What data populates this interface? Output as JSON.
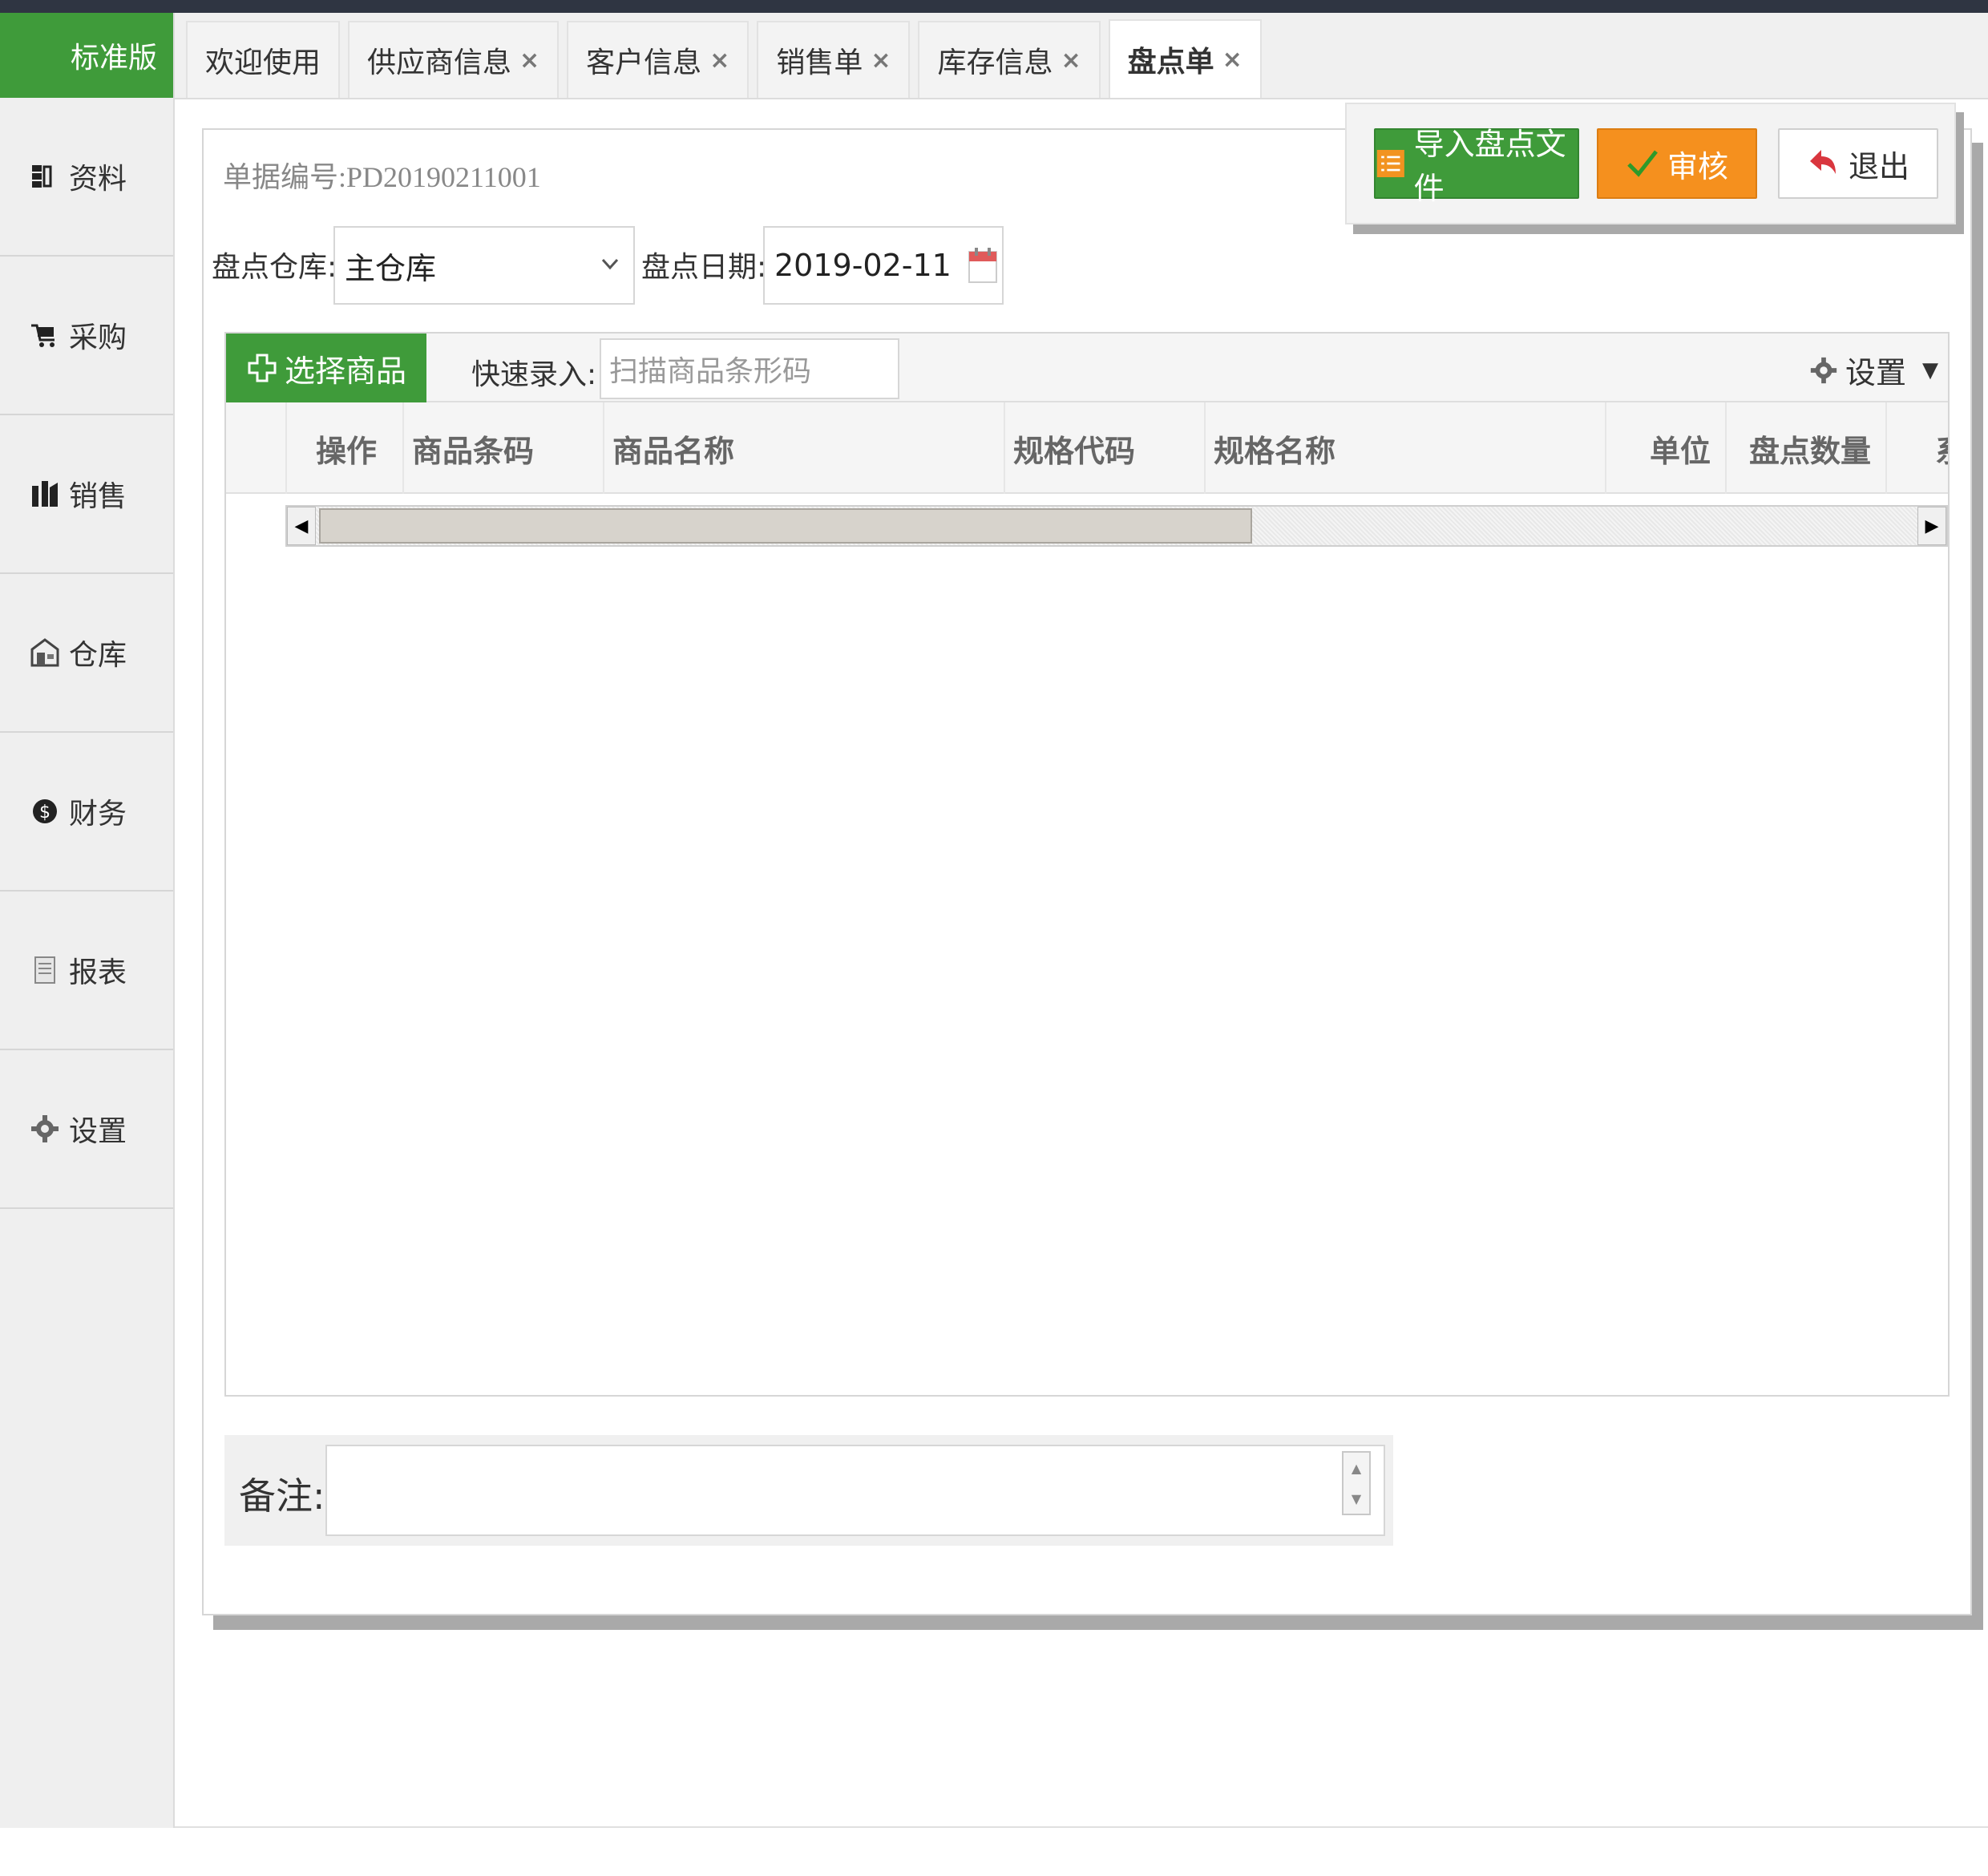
{
  "brand": "标准版",
  "sidebar": {
    "items": [
      {
        "label": "资料",
        "icon": "database-icon"
      },
      {
        "label": "采购",
        "icon": "cart-icon"
      },
      {
        "label": "销售",
        "icon": "sales-icon"
      },
      {
        "label": "仓库",
        "icon": "warehouse-icon"
      },
      {
        "label": "财务",
        "icon": "money-icon"
      },
      {
        "label": "报表",
        "icon": "report-icon"
      },
      {
        "label": "设置",
        "icon": "gear-icon"
      }
    ]
  },
  "tabs": [
    {
      "label": "欢迎使用",
      "closable": false
    },
    {
      "label": "供应商信息",
      "closable": true
    },
    {
      "label": "客户信息",
      "closable": true
    },
    {
      "label": "销售单",
      "closable": true
    },
    {
      "label": "库存信息",
      "closable": true
    },
    {
      "label": "盘点单",
      "closable": true,
      "active": true
    }
  ],
  "tab_close_glyph": "×",
  "toolbar": {
    "import_label": "导入盘点文件",
    "audit_label": "审核",
    "exit_label": "退出"
  },
  "form": {
    "bill_no_label": "单据编号:",
    "bill_no_value": "PD20190211001",
    "warehouse_label": "盘点仓库:",
    "warehouse_value": "主仓库",
    "date_label": "盘点日期:",
    "date_value": "2019-02-11"
  },
  "grid": {
    "select_goods_label": "选择商品",
    "quick_entry_label": "快速录入:",
    "quick_entry_placeholder": "扫描商品条形码",
    "settings_label": "设置",
    "columns": [
      "操作",
      "商品条码",
      "商品名称",
      "规格代码",
      "规格名称",
      "单位",
      "盘点数量",
      "系"
    ]
  },
  "remark": {
    "label": "备注:",
    "value": ""
  },
  "colors": {
    "brand_green": "#3f9b3a",
    "audit_orange": "#f5901e"
  }
}
